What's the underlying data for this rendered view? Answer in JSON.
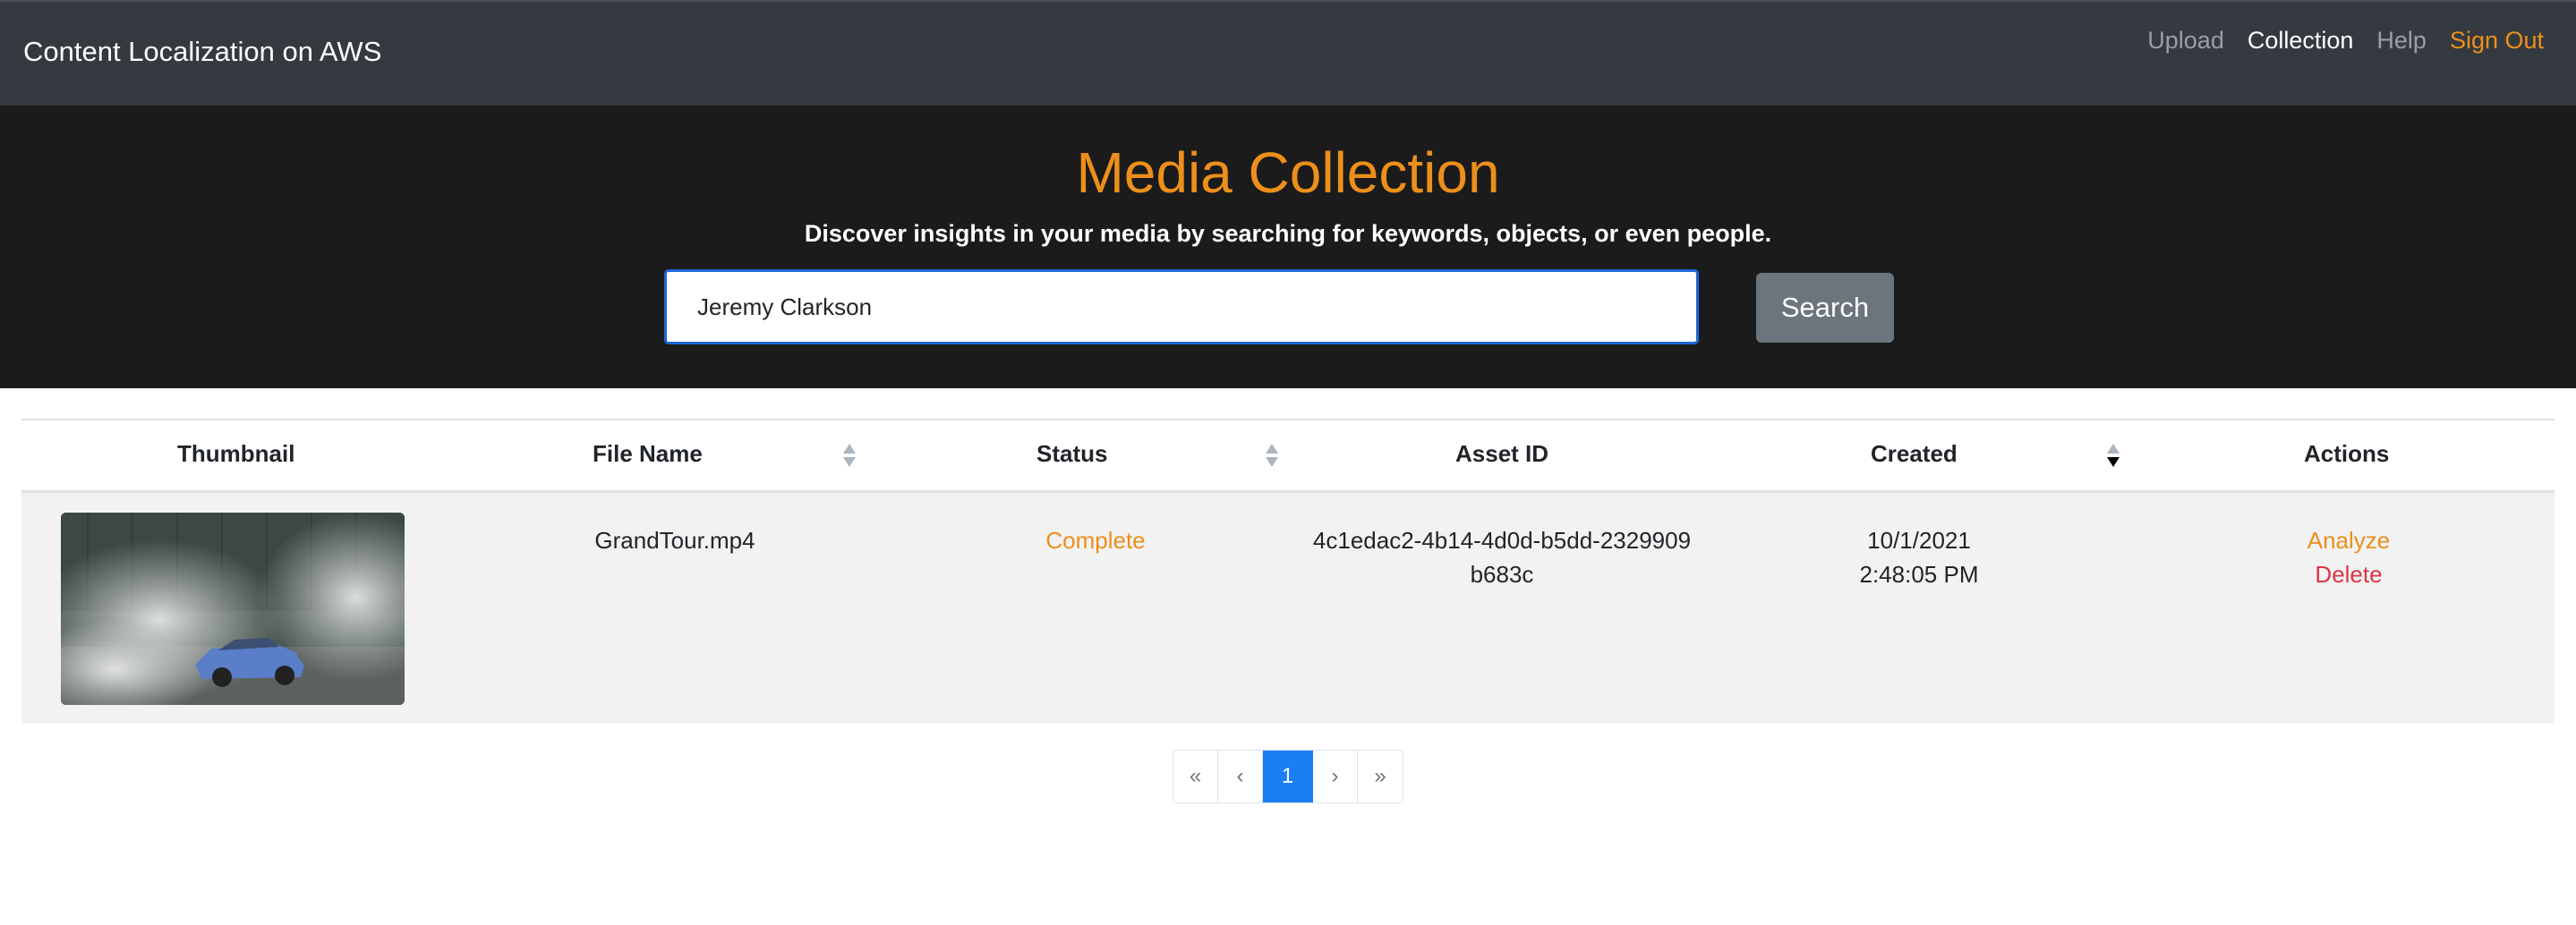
{
  "navbar": {
    "brand": "Content Localization on AWS",
    "links": {
      "upload": "Upload",
      "collection": "Collection",
      "help": "Help",
      "sign_out": "Sign Out"
    }
  },
  "hero": {
    "title": "Media Collection",
    "subtitle": "Discover insights in your media by searching for keywords, objects, or even people.",
    "search_value": "Jeremy Clarkson",
    "search_button": "Search"
  },
  "table": {
    "headers": {
      "thumbnail": "Thumbnail",
      "file_name": "File Name",
      "status": "Status",
      "asset_id": "Asset ID",
      "created": "Created",
      "actions": "Actions"
    },
    "sort": {
      "file_name": "none",
      "status": "none",
      "created": "descending"
    },
    "rows": [
      {
        "file_name": "GrandTour.mp4",
        "status": "Complete",
        "asset_id_line1": "4c1edac2-4b14-4d0d-b5dd-2329909",
        "asset_id_line2": "b683c",
        "created_date": "10/1/2021",
        "created_time": "2:48:05 PM",
        "action_analyze": "Analyze",
        "action_delete": "Delete"
      }
    ]
  },
  "pagination": {
    "first": "«",
    "prev": "‹",
    "current": "1",
    "next": "›",
    "last": "»"
  },
  "colors": {
    "accent_orange": "#ec8f1b",
    "delete_red": "#dc3545",
    "page_active": "#1a7ef5",
    "navbar_bg": "#343a40",
    "hero_bg": "#1b1b1b"
  }
}
